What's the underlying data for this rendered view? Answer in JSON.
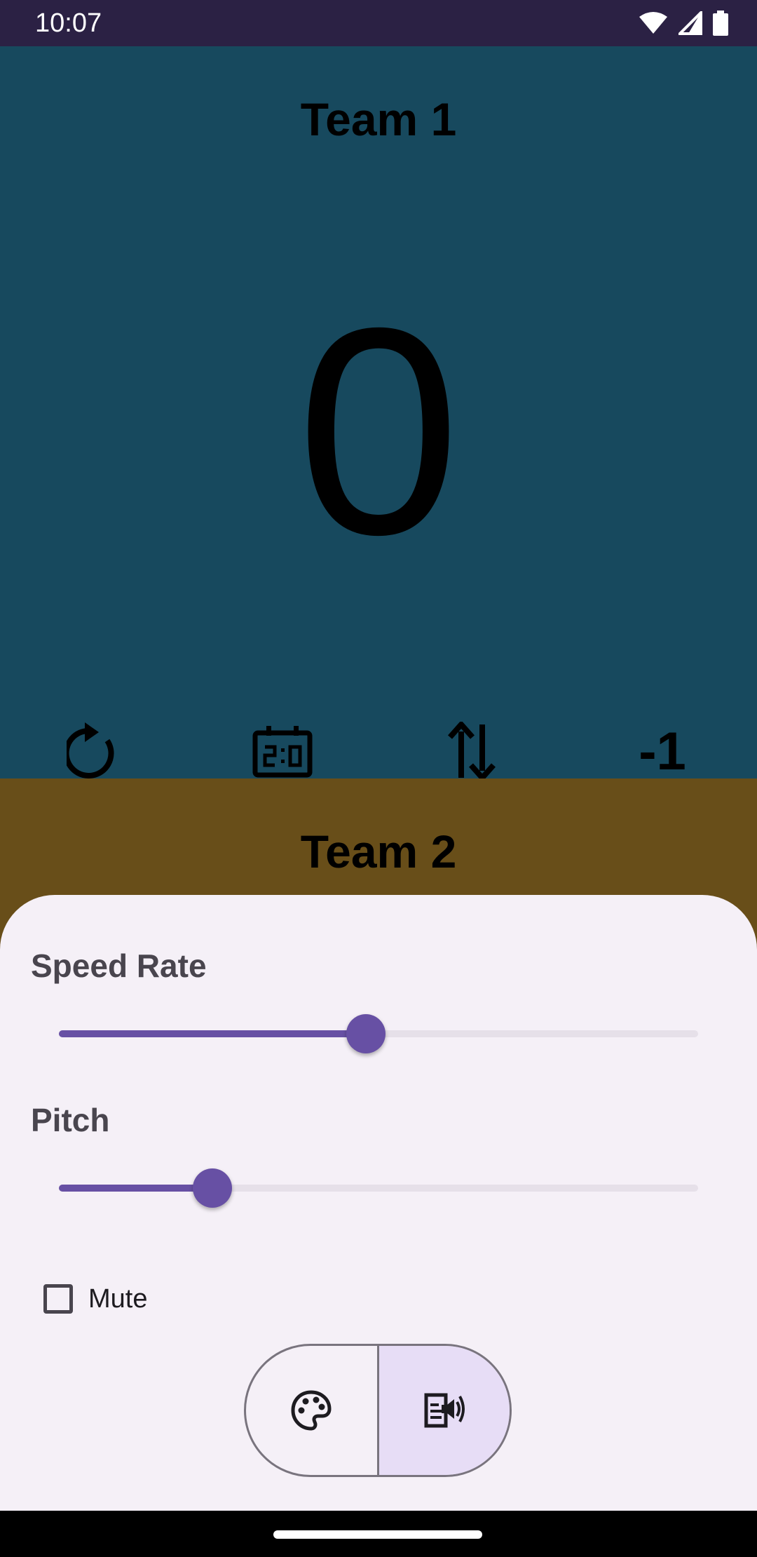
{
  "status_bar": {
    "time": "10:07",
    "icons": [
      "wifi-icon",
      "cellular-signal-icon",
      "battery-icon"
    ]
  },
  "team1": {
    "name": "Team 1",
    "score": "0",
    "color": "#17495e",
    "controls": {
      "reset_icon": "reset-icon",
      "scoreboard_icon": "scoreboard-icon",
      "swap_icon": "swap-icon",
      "minus_label": "-1"
    }
  },
  "team2": {
    "name": "Team 2",
    "color": "#684e19"
  },
  "sheet": {
    "speed_rate": {
      "label": "Speed Rate",
      "value_fraction": 0.48
    },
    "pitch": {
      "label": "Pitch",
      "value_fraction": 0.24
    },
    "mute": {
      "label": "Mute",
      "checked": false
    },
    "segmented": {
      "left_icon": "palette-icon",
      "right_icon": "text-to-speech-icon",
      "selected": "right"
    }
  },
  "colors": {
    "accent": "#6750a4",
    "status_bar": "#2b2144",
    "sheet_background": "#f5f0f7"
  }
}
